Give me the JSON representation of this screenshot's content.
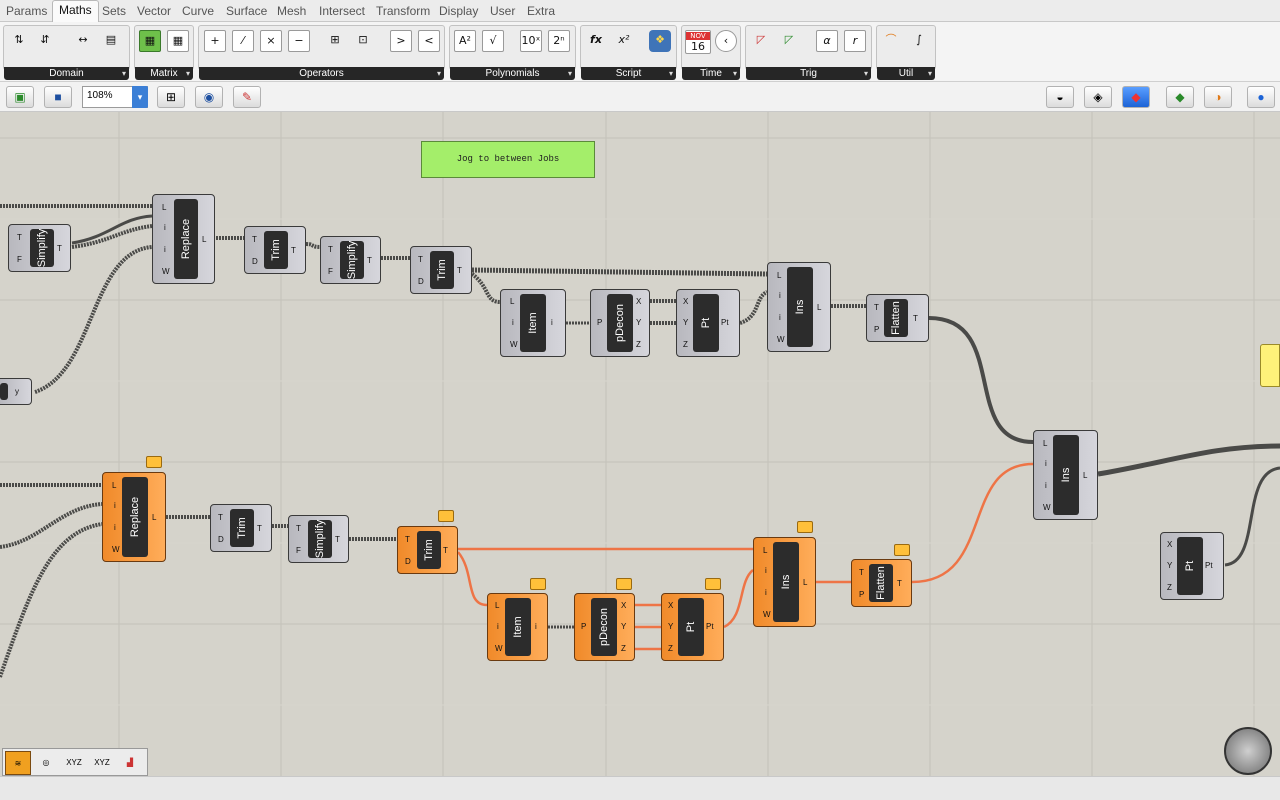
{
  "menu": [
    "Params",
    "Maths",
    "Sets",
    "Vector",
    "Curve",
    "Surface",
    "Mesh",
    "Intersect",
    "Transform",
    "Display",
    "User",
    "Extra"
  ],
  "active_tab": "Maths",
  "ribbon_groups": [
    "Domain",
    "Matrix",
    "Operators",
    "Polynomials",
    "Script",
    "Time",
    "Trig",
    "Util"
  ],
  "ribbon_icons": {
    "operators": [
      "+",
      "⁄",
      "×",
      "−",
      "⊞",
      "⊡",
      ">",
      "<"
    ],
    "polynomials": [
      "A²",
      "√",
      "10ˣ",
      "2ⁿ"
    ],
    "script": [
      "fx",
      "x²"
    ],
    "time_month": "NOV",
    "time_day": "16",
    "trig": [
      "α",
      "r"
    ]
  },
  "zoom": "108%",
  "panel_text": "Jog to between Jobs",
  "nodes": {
    "simplify": "Simplify",
    "replace": "Replace",
    "trim": "Trim",
    "item": "Item",
    "pdecon": "pDecon",
    "pt": "Pt",
    "ins": "Ins",
    "flatten": "Flatten"
  },
  "ports": {
    "T": "T",
    "F": "F",
    "D": "D",
    "L": "L",
    "i": "i",
    "W": "W",
    "P": "P",
    "X": "X",
    "Y": "Y",
    "Z": "Z",
    "Pt": "Pt",
    "y": "y"
  },
  "colors": {
    "wire": "#4a4a48",
    "selected_wire": "#ee7446",
    "selected_node": "#f59a3c",
    "panel": "#a4ee6a",
    "canvas": "#d5d3cb"
  }
}
